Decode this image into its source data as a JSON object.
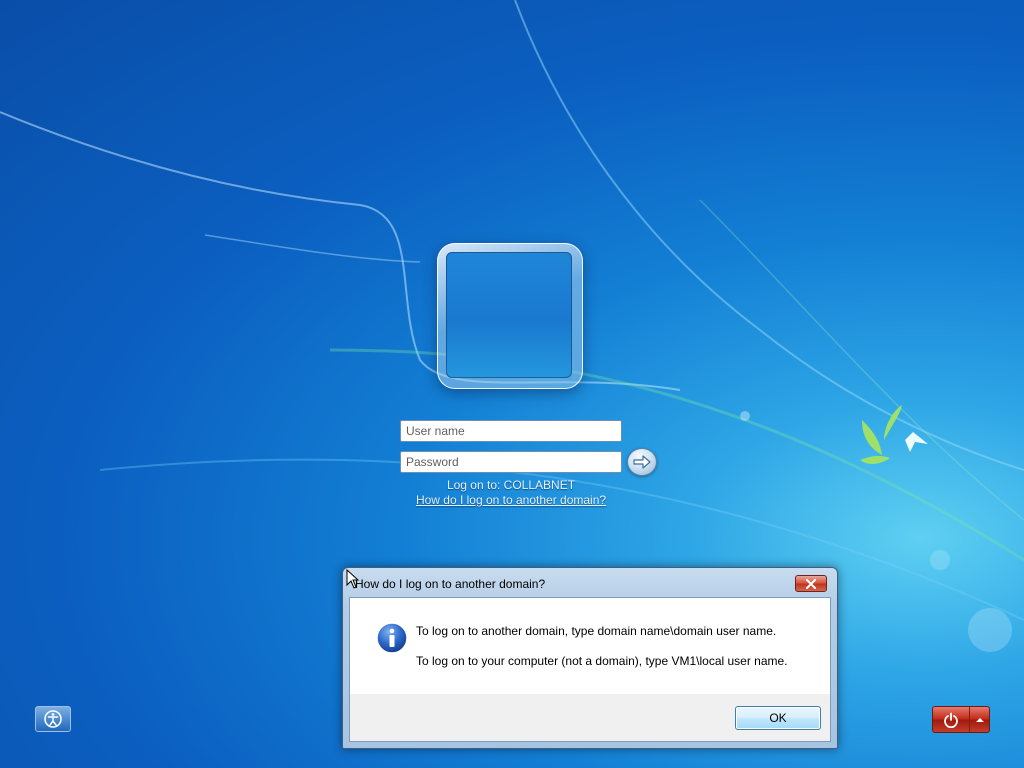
{
  "login": {
    "username_placeholder": "User name",
    "password_placeholder": "Password",
    "logon_to_text": "Log on to: COLLABNET",
    "help_link": "How do I log on to another domain?"
  },
  "dialog": {
    "title": "How do I log on to another domain?",
    "message_line1": "To log on to another domain, type domain name\\domain user name.",
    "message_line2": "To log on to your computer (not a domain), type VM1\\local user name.",
    "ok_label": "OK"
  },
  "icons": {
    "submit": "arrow-right-icon",
    "dialog_close": "close-icon",
    "dialog_info": "info-icon",
    "ease_of_access": "ease-of-access-icon",
    "power": "power-icon",
    "power_options": "chevron-up-icon"
  },
  "colors": {
    "background": "#0b5fc0",
    "power_button": "#c22a19",
    "dialog_close": "#c1341d"
  }
}
